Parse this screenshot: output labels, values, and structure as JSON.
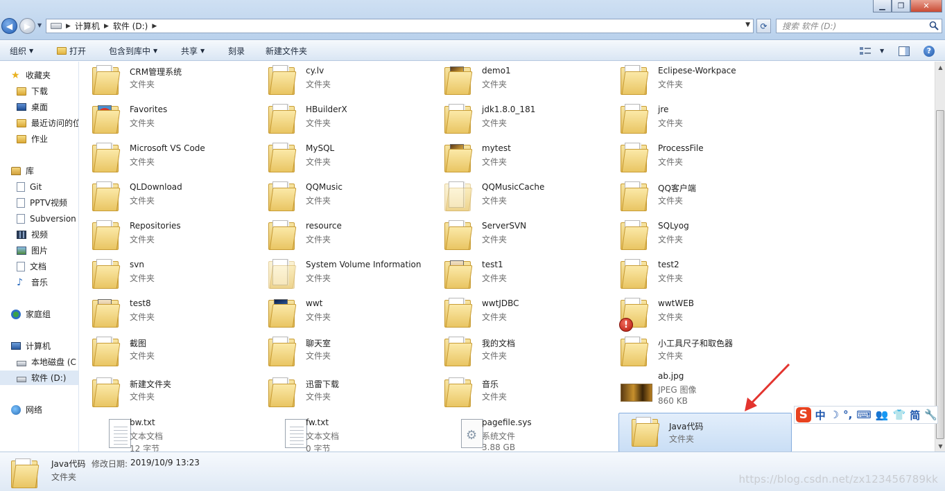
{
  "window": {
    "minimize": "▁",
    "maximize": "❐",
    "close": "✕"
  },
  "address": {
    "segments": [
      "计算机",
      "软件 (D:)"
    ]
  },
  "search": {
    "placeholder": "搜索 软件 (D:)"
  },
  "toolbar": {
    "organize": "组织",
    "open": "打开",
    "include_library": "包含到库中",
    "share": "共享",
    "burn": "刻录",
    "new_folder": "新建文件夹"
  },
  "sidebar": {
    "items": [
      {
        "label": "收藏夹",
        "icon": "star-icon"
      },
      {
        "label": "下载",
        "icon": "folder-icon"
      },
      {
        "label": "桌面",
        "icon": "desktop-icon"
      },
      {
        "label": "最近访问的位",
        "icon": "recent-icon"
      },
      {
        "label": "作业",
        "icon": "folder-icon"
      },
      {
        "label": "库",
        "icon": "library-icon"
      },
      {
        "label": "Git",
        "icon": "document-icon"
      },
      {
        "label": "PPTV视频",
        "icon": "document-icon"
      },
      {
        "label": "Subversion",
        "icon": "document-icon"
      },
      {
        "label": "视频",
        "icon": "video-icon"
      },
      {
        "label": "图片",
        "icon": "picture-icon"
      },
      {
        "label": "文档",
        "icon": "document-icon"
      },
      {
        "label": "音乐",
        "icon": "music-icon"
      },
      {
        "label": "家庭组",
        "icon": "homegroup-icon"
      },
      {
        "label": "计算机",
        "icon": "computer-icon"
      },
      {
        "label": "本地磁盘 (C",
        "icon": "drive-icon"
      },
      {
        "label": "软件 (D:)",
        "icon": "drive-icon"
      },
      {
        "label": "网络",
        "icon": "network-icon"
      }
    ]
  },
  "files": [
    {
      "name": "CRM管理系统",
      "type": "文件夹",
      "kind": "folder"
    },
    {
      "name": "cy.lv",
      "type": "文件夹",
      "kind": "folder"
    },
    {
      "name": "demo1",
      "type": "文件夹",
      "kind": "folder-photo"
    },
    {
      "name": "Eclipese-Workpace",
      "type": "文件夹",
      "kind": "folder"
    },
    {
      "name": "Favorites",
      "type": "文件夹",
      "kind": "folder-red"
    },
    {
      "name": "HBuilderX",
      "type": "文件夹",
      "kind": "folder"
    },
    {
      "name": "jdk1.8.0_181",
      "type": "文件夹",
      "kind": "folder"
    },
    {
      "name": "jre",
      "type": "文件夹",
      "kind": "folder"
    },
    {
      "name": "Microsoft VS Code",
      "type": "文件夹",
      "kind": "folder"
    },
    {
      "name": "MySQL",
      "type": "文件夹",
      "kind": "folder"
    },
    {
      "name": "mytest",
      "type": "文件夹",
      "kind": "folder-photo"
    },
    {
      "name": "ProcessFile",
      "type": "文件夹",
      "kind": "folder"
    },
    {
      "name": "QLDownload",
      "type": "文件夹",
      "kind": "folder"
    },
    {
      "name": "QQMusic",
      "type": "文件夹",
      "kind": "folder"
    },
    {
      "name": "QQMusicCache",
      "type": "文件夹",
      "kind": "folder-ghost"
    },
    {
      "name": "QQ客户端",
      "type": "文件夹",
      "kind": "folder"
    },
    {
      "name": "Repositories",
      "type": "文件夹",
      "kind": "folder"
    },
    {
      "name": "resource",
      "type": "文件夹",
      "kind": "folder"
    },
    {
      "name": "ServerSVN",
      "type": "文件夹",
      "kind": "folder"
    },
    {
      "name": "SQLyog",
      "type": "文件夹",
      "kind": "folder"
    },
    {
      "name": "svn",
      "type": "文件夹",
      "kind": "folder"
    },
    {
      "name": "System Volume Information",
      "type": "文件夹",
      "kind": "folder-ghost"
    },
    {
      "name": "test1",
      "type": "文件夹",
      "kind": "folder-girl"
    },
    {
      "name": "test2",
      "type": "文件夹",
      "kind": "folder"
    },
    {
      "name": "test8",
      "type": "文件夹",
      "kind": "folder-girl"
    },
    {
      "name": "wwt",
      "type": "文件夹",
      "kind": "folder-blue"
    },
    {
      "name": "wwtJDBC",
      "type": "文件夹",
      "kind": "folder"
    },
    {
      "name": "wwtWEB",
      "type": "文件夹",
      "kind": "folder-warn"
    },
    {
      "name": "截图",
      "type": "文件夹",
      "kind": "folder"
    },
    {
      "name": "聊天室",
      "type": "文件夹",
      "kind": "folder"
    },
    {
      "name": "我的文档",
      "type": "文件夹",
      "kind": "folder"
    },
    {
      "name": "小工具尺子和取色器",
      "type": "文件夹",
      "kind": "folder"
    },
    {
      "name": "新建文件夹",
      "type": "文件夹",
      "kind": "folder"
    },
    {
      "name": "迅雷下载",
      "type": "文件夹",
      "kind": "folder"
    },
    {
      "name": "音乐",
      "type": "文件夹",
      "kind": "folder"
    },
    {
      "name": "ab.jpg",
      "type": "JPEG 图像",
      "size": "860 KB",
      "kind": "jpg"
    },
    {
      "name": "bw.txt",
      "type": "文本文档",
      "size": "12 字节",
      "kind": "txt"
    },
    {
      "name": "fw.txt",
      "type": "文本文档",
      "size": "0 字节",
      "kind": "txt"
    },
    {
      "name": "pagefile.sys",
      "type": "系统文件",
      "size": "3.88 GB",
      "kind": "sys"
    },
    {
      "name": "Java代码",
      "type": "文件夹",
      "kind": "folder",
      "selected": true
    }
  ],
  "details": {
    "name": "Java代码",
    "modified_label": "修改日期:",
    "modified_date": "2019/10/9 13:23",
    "type": "文件夹"
  },
  "ime": {
    "logo": "S",
    "items": [
      "中",
      "☽",
      "°,",
      "⌨",
      "👥",
      "👕",
      "简",
      "🔧"
    ]
  },
  "watermark": "https://blog.csdn.net/zx123456789kk",
  "colors": {
    "selection": "#c9def5",
    "arrow": "#e3342f",
    "ime_logo": "#e8421f"
  }
}
